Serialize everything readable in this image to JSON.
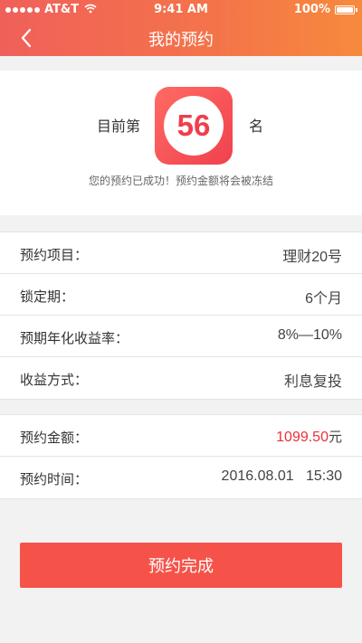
{
  "status_bar": {
    "carrier": "AT&T",
    "time": "9:41 AM",
    "battery_text": "100%",
    "battery_level": 1.0
  },
  "nav": {
    "title": "我的预约",
    "back_icon": "chevron-left-icon"
  },
  "rank": {
    "prefix": "目前第",
    "number": "56",
    "suffix": "名",
    "note": "您的预约已成功！预约金额将会被冻结"
  },
  "details": [
    {
      "label": "预约项目：",
      "value": "理财20号"
    },
    {
      "label": "锁定期：",
      "value": "6个月"
    },
    {
      "label": "预期年化收益率：",
      "value": "8%—10%"
    },
    {
      "label": "收益方式：",
      "value": "利息复投"
    }
  ],
  "summary": {
    "amount_label": "预约金额：",
    "amount_value": "1099.50",
    "amount_unit": "元",
    "time_label": "预约时间：",
    "time_value": "2016.08.01   15:30"
  },
  "actions": {
    "finish_label": "预约完成"
  },
  "colors": {
    "header_start": "#f0605a",
    "header_end": "#f78a3c",
    "accent_red": "#ee2e36",
    "button": "#f55349"
  }
}
